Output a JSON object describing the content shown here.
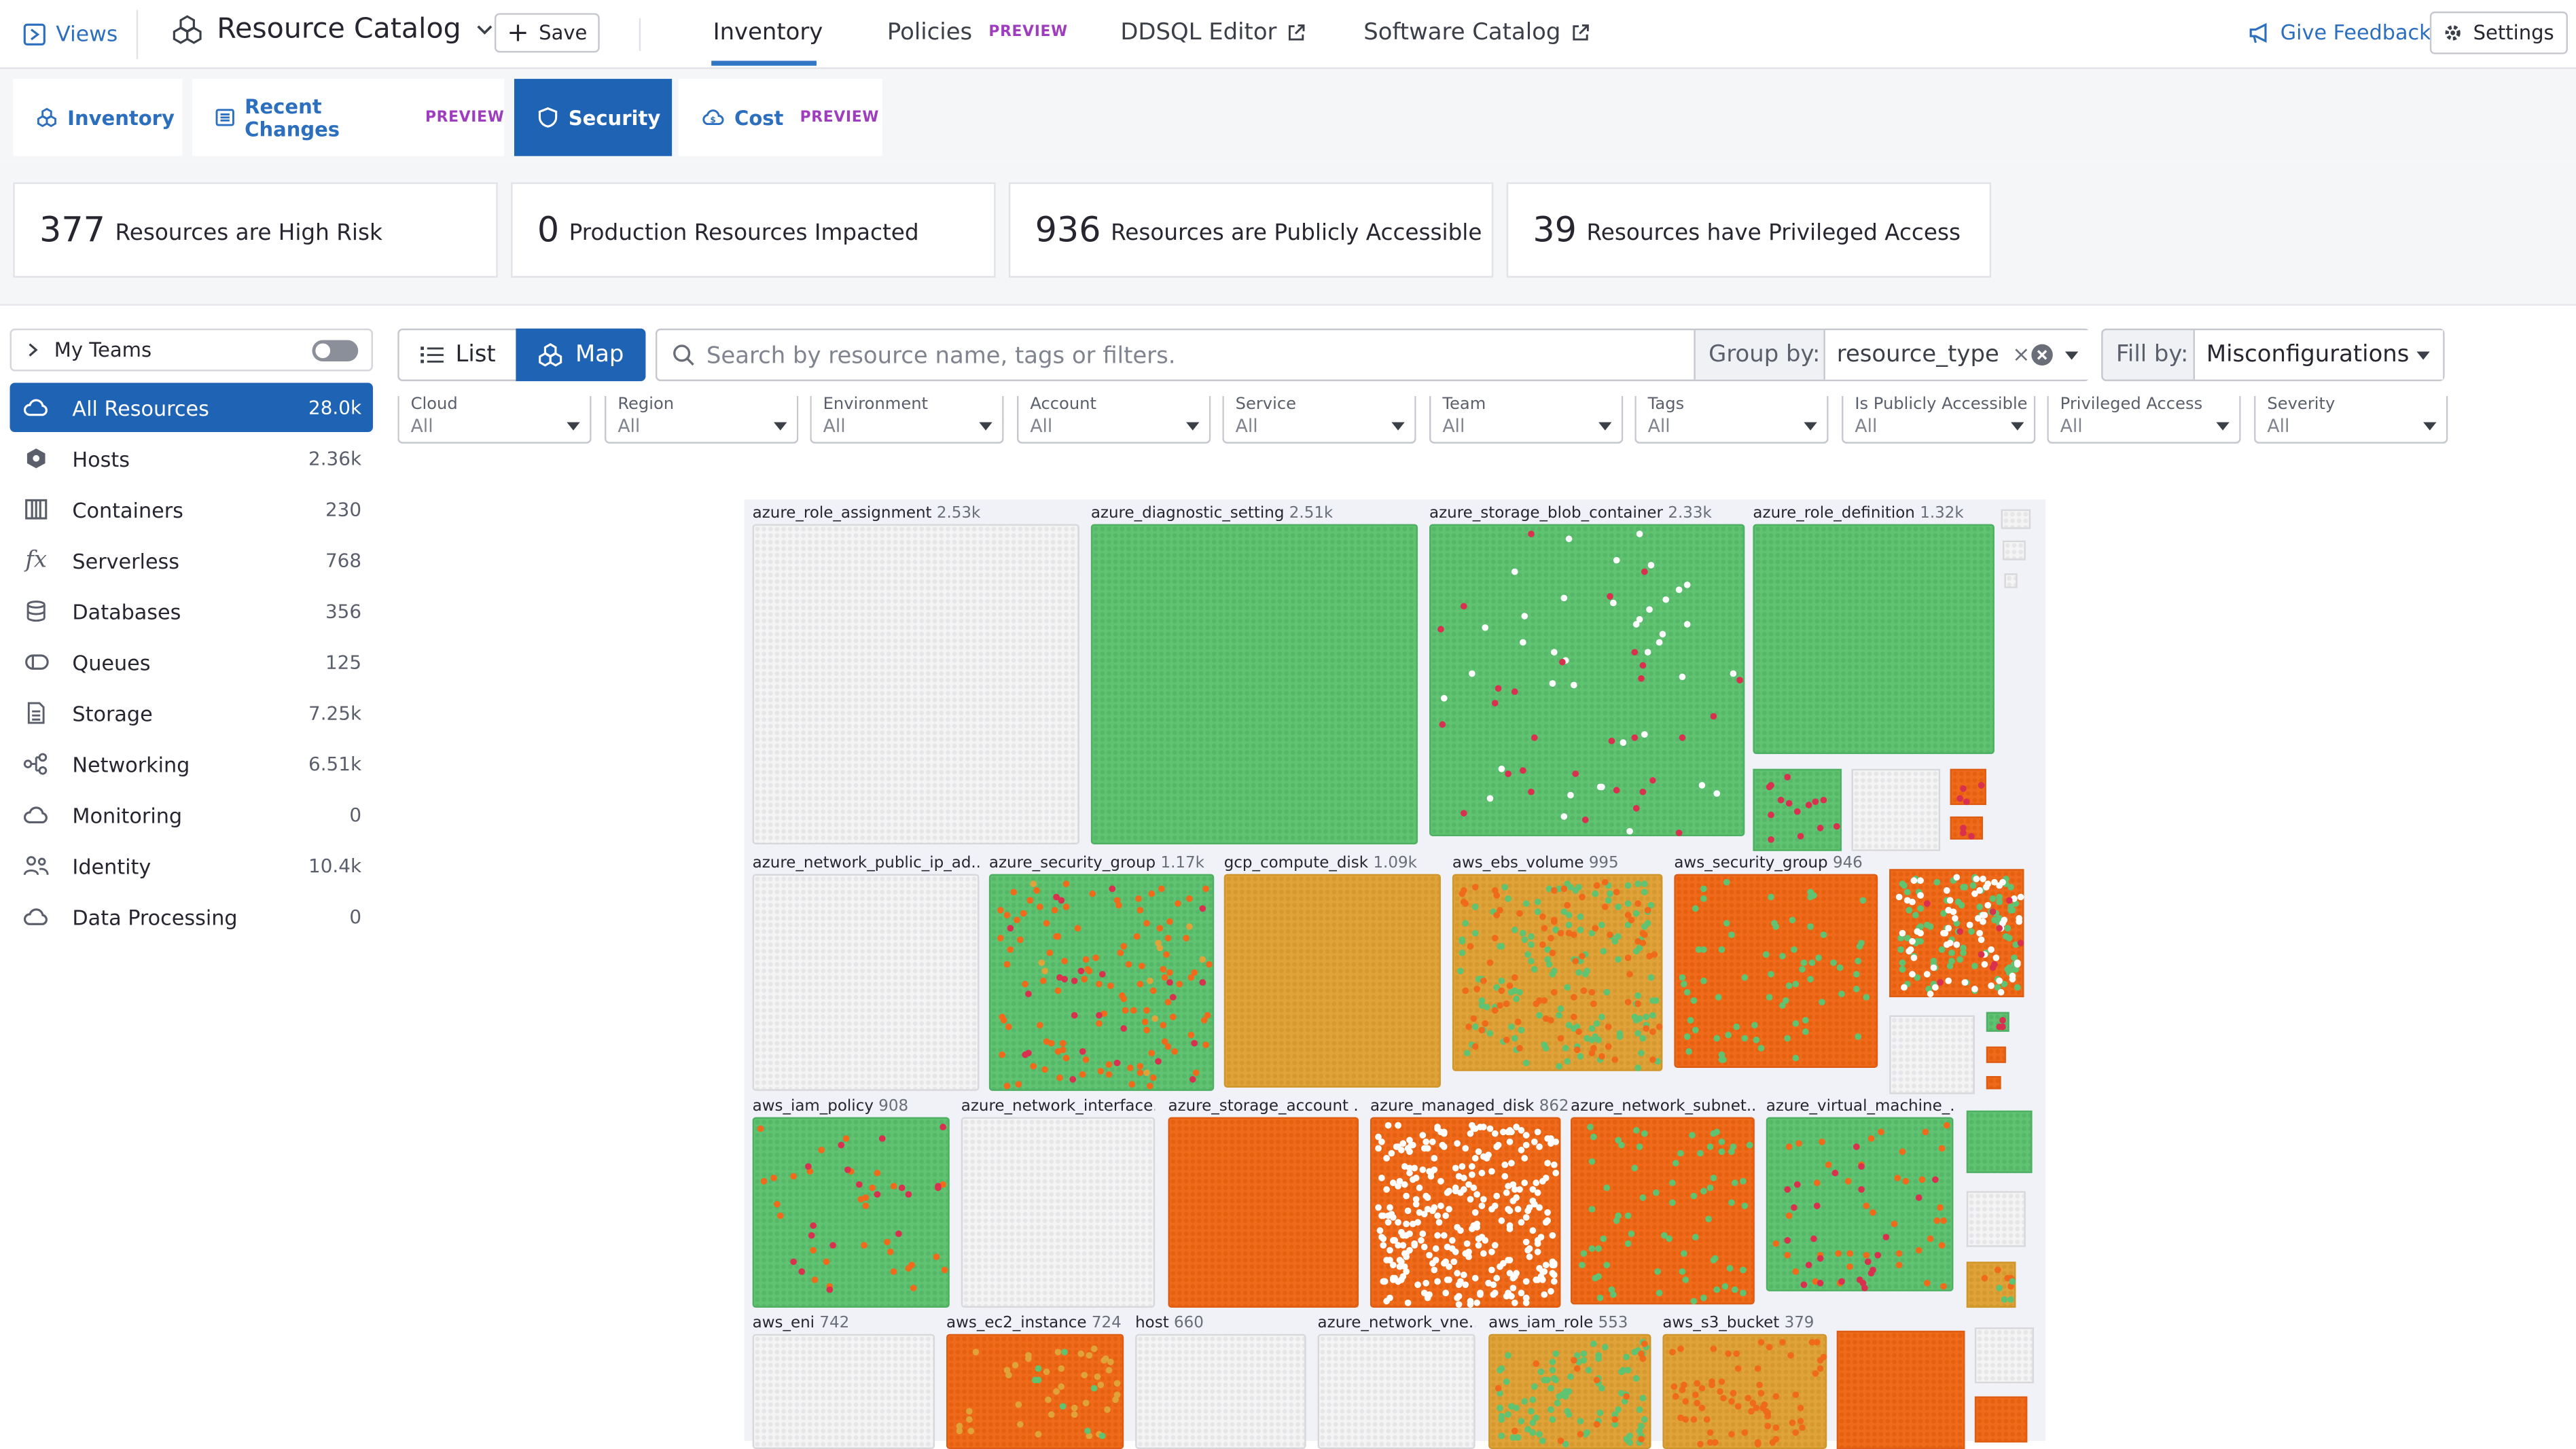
{
  "topbar": {
    "views_label": "Views",
    "app_title": "Resource Catalog",
    "save_label": "Save",
    "nav": [
      {
        "label": "Inventory",
        "badge": ""
      },
      {
        "label": "Policies",
        "badge": "PREVIEW"
      },
      {
        "label": "DDSQL Editor",
        "badge": ""
      },
      {
        "label": "Software Catalog",
        "badge": ""
      }
    ],
    "feedback_label": "Give Feedback",
    "settings_label": "Settings"
  },
  "tabs": [
    {
      "label": "Inventory",
      "badge": ""
    },
    {
      "label": "Recent Changes",
      "badge": "PREVIEW"
    },
    {
      "label": "Security",
      "badge": ""
    },
    {
      "label": "Cost",
      "badge": "PREVIEW"
    }
  ],
  "stats": [
    {
      "num": "377",
      "label": "Resources are High Risk"
    },
    {
      "num": "0",
      "label": "Production Resources Impacted"
    },
    {
      "num": "936",
      "label": "Resources are Publicly Accessible"
    },
    {
      "num": "39",
      "label": "Resources have Privileged Access"
    }
  ],
  "sidebar": {
    "my_teams_label": "My Teams",
    "items": [
      {
        "label": "All Resources",
        "count": "28.0k",
        "icon": "cloud-icon"
      },
      {
        "label": "Hosts",
        "count": "2.36k",
        "icon": "hexagon-icon"
      },
      {
        "label": "Containers",
        "count": "230",
        "icon": "container-icon"
      },
      {
        "label": "Serverless",
        "count": "768",
        "icon": "function-icon"
      },
      {
        "label": "Databases",
        "count": "356",
        "icon": "database-icon"
      },
      {
        "label": "Queues",
        "count": "125",
        "icon": "queue-icon"
      },
      {
        "label": "Storage",
        "count": "7.25k",
        "icon": "document-icon"
      },
      {
        "label": "Networking",
        "count": "6.51k",
        "icon": "network-icon"
      },
      {
        "label": "Monitoring",
        "count": "0",
        "icon": "cloud-icon"
      },
      {
        "label": "Identity",
        "count": "10.4k",
        "icon": "users-icon"
      },
      {
        "label": "Data Processing",
        "count": "0",
        "icon": "cloud-icon"
      }
    ]
  },
  "view_toggle": {
    "list_label": "List",
    "map_label": "Map",
    "selected": "Map"
  },
  "search": {
    "placeholder": "Search by resource name, tags or filters.",
    "value": ""
  },
  "group_by": {
    "label": "Group by:",
    "value": "resource_type"
  },
  "fill_by": {
    "label": "Fill by:",
    "value": "Misconfigurations"
  },
  "filters": [
    {
      "label": "Cloud",
      "value": "All"
    },
    {
      "label": "Region",
      "value": "All"
    },
    {
      "label": "Environment",
      "value": "All"
    },
    {
      "label": "Account",
      "value": "All"
    },
    {
      "label": "Service",
      "value": "All"
    },
    {
      "label": "Team",
      "value": "All"
    },
    {
      "label": "Tags",
      "value": "All"
    },
    {
      "label": "Is Publicly Accessible",
      "value": "All"
    },
    {
      "label": "Privileged Access",
      "value": "All"
    },
    {
      "label": "Severity",
      "value": "All"
    }
  ],
  "colors": {
    "accent": "#1f63b5",
    "link": "#2c6fbf",
    "preview": "#9f3dbf",
    "ok": "#5fc372",
    "high": "#ef6b1b",
    "medium": "#dfa33a",
    "critical": "#d9304f",
    "none": "#f4f4f4"
  },
  "map": {
    "groups": [
      {
        "name": "azure_role_assignment",
        "count": "2.53k",
        "fill": "grey"
      },
      {
        "name": "azure_diagnostic_setting",
        "count": "2.51k",
        "fill": "green"
      },
      {
        "name": "azure_storage_blob_container",
        "count": "2.33k",
        "fill": "green"
      },
      {
        "name": "azure_role_definition",
        "count": "1.32k",
        "fill": "green"
      },
      {
        "name": "azure_network_public_ip_ad...",
        "count": "",
        "fill": "grey"
      },
      {
        "name": "azure_security_group",
        "count": "1.17k",
        "fill": "green"
      },
      {
        "name": "gcp_compute_disk",
        "count": "1.09k",
        "fill": "yellow"
      },
      {
        "name": "aws_ebs_volume",
        "count": "995",
        "fill": "yellow"
      },
      {
        "name": "aws_security_group",
        "count": "946",
        "fill": "orange"
      },
      {
        "name": "aws_iam_policy",
        "count": "908",
        "fill": "green"
      },
      {
        "name": "azure_network_interface...",
        "count": "",
        "fill": "grey"
      },
      {
        "name": "azure_storage_account ...",
        "count": "",
        "fill": "orange"
      },
      {
        "name": "azure_managed_disk",
        "count": "862",
        "fill": "orange"
      },
      {
        "name": "azure_network_subnet...",
        "count": "",
        "fill": "orange"
      },
      {
        "name": "azure_virtual_machine_...",
        "count": "",
        "fill": "green"
      },
      {
        "name": "aws_eni",
        "count": "742",
        "fill": "grey"
      },
      {
        "name": "aws_ec2_instance",
        "count": "724",
        "fill": "orange"
      },
      {
        "name": "host",
        "count": "660",
        "fill": "grey"
      },
      {
        "name": "azure_network_vne...",
        "count": "",
        "fill": "grey"
      },
      {
        "name": "aws_iam_role",
        "count": "553",
        "fill": "yellow"
      },
      {
        "name": "aws_s3_bucket",
        "count": "379",
        "fill": "yellow"
      }
    ]
  }
}
